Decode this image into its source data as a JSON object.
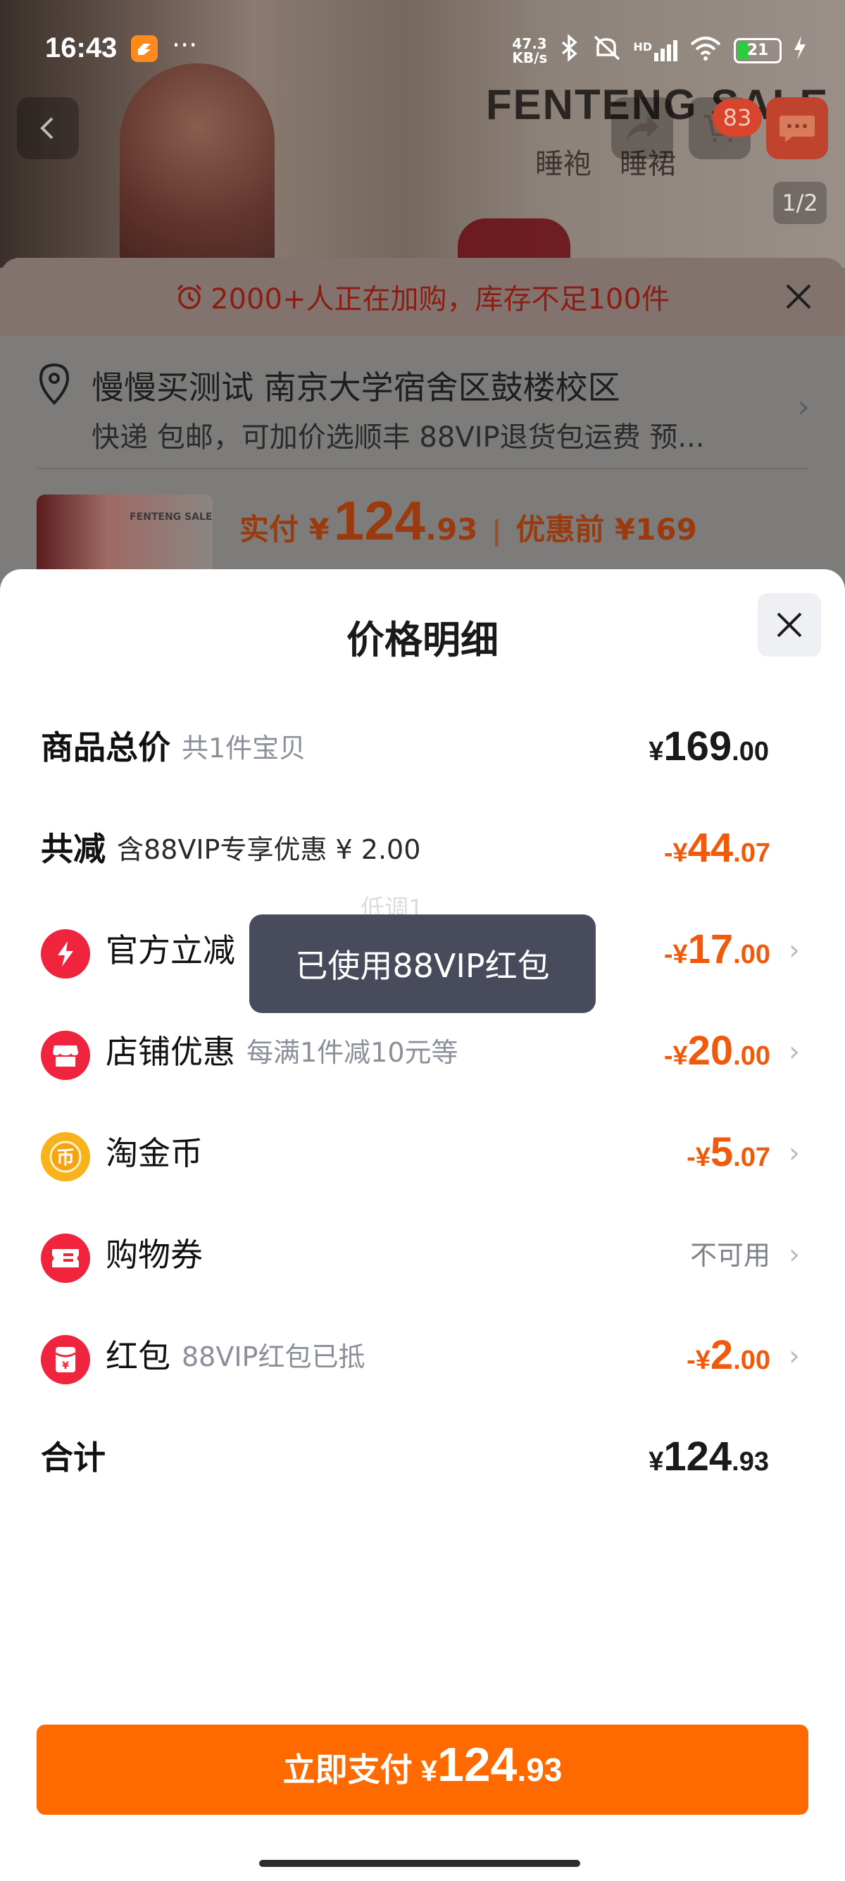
{
  "status_bar": {
    "time": "16:43",
    "more": "···",
    "net_speed_top": "47.3",
    "net_speed_bottom": "KB/s",
    "signal_tag": "HD",
    "battery": "21"
  },
  "product_page": {
    "brand_title": "FENTENG SALE",
    "brand_subs": [
      "睡袍",
      "睡裙"
    ],
    "cart_badge": "83",
    "page_indicator": "1/2",
    "thumb_brand": "FENTENG SALE"
  },
  "order_sheet": {
    "banner": "2000+人正在加购，库存不足100件",
    "address_title": "慢慢买测试 南京大学宿舍区鼓楼校区",
    "address_sub": "快递 包邮，可加价选顺丰 88VIP退货包运费 预...",
    "pay_label": "实付 ¥",
    "pay_int": "124",
    "pay_dec": ".93",
    "pre_label": "优惠前 ¥169"
  },
  "price_detail": {
    "title": "价格明细",
    "rows": [
      {
        "label": "商品总价",
        "sub": "共1件宝贝",
        "sym": "¥",
        "int": "169",
        "dec": ".00"
      },
      {
        "label": "共减",
        "sub": "含88VIP专享优惠 ¥ 2.00",
        "sym": "-¥",
        "int": "44",
        "dec": ".07"
      },
      {
        "label": "官方立减",
        "sub": "",
        "sym": "-¥",
        "int": "17",
        "dec": ".00",
        "icon": "lightning-icon"
      },
      {
        "label": "店铺优惠",
        "sub": "每满1件减10元等",
        "sym": "-¥",
        "int": "20",
        "dec": ".00",
        "icon": "store-icon"
      },
      {
        "label": "淘金币",
        "sub": "",
        "sym": "-¥",
        "int": "5",
        "dec": ".07",
        "icon": "coin-icon"
      },
      {
        "label": "购物券",
        "sub": "",
        "status": "不可用",
        "icon": "coupon-icon"
      },
      {
        "label": "红包",
        "sub": "88VIP红包已抵",
        "sym": "-¥",
        "int": "2",
        "dec": ".00",
        "icon": "red-packet-icon"
      },
      {
        "label": "合计",
        "sub": "",
        "sym": "¥",
        "int": "124",
        "dec": ".93"
      }
    ],
    "ghost_text": "低调1",
    "toast": "已使用88VIP红包"
  },
  "pay_button": {
    "label": "立即支付",
    "sym": "¥",
    "int": "124",
    "dec": ".93"
  },
  "colors": {
    "accent_orange": "#ff6a00",
    "discount_orange": "#f05a0a",
    "icon_red": "#f0243c",
    "coin_gold": "#f7b21c"
  }
}
